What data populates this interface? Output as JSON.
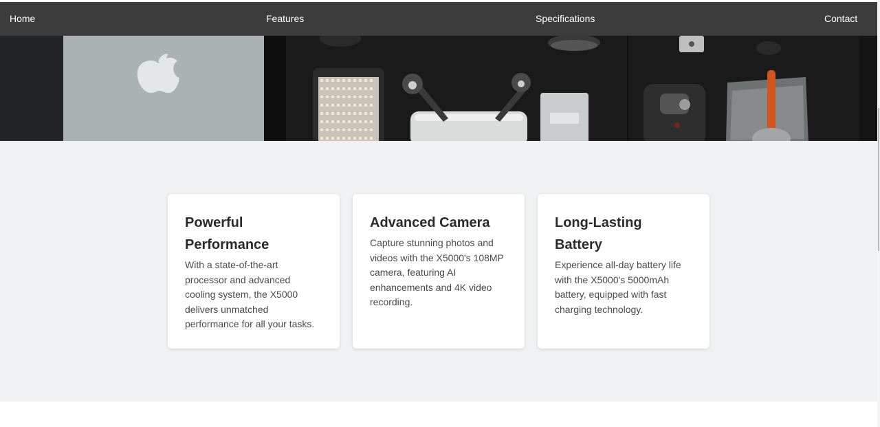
{
  "nav": {
    "home": "Home",
    "features": "Features",
    "specifications": "Specifications",
    "contact": "Contact"
  },
  "hero": {
    "image": "flat-lay-of-laptop-drone-led-light-and-camera-gear",
    "tone": "grayscale with orange accent"
  },
  "features": [
    {
      "title": "Powerful Performance",
      "text": "With a state-of-the-art processor and advanced cooling system, the X5000 delivers unmatched performance for all your tasks."
    },
    {
      "title": "Advanced Camera",
      "text": "Capture stunning photos and videos with the X5000's 108MP camera, featuring AI enhancements and 4K video recording."
    },
    {
      "title": "Long-Lasting Battery",
      "text": "Experience all-day battery life with the X5000's 5000mAh battery, equipped with fast charging technology."
    }
  ],
  "colors": {
    "navbar": "#3c3c3c",
    "section_bg": "#f0f1f3",
    "card_bg": "#ffffff",
    "heading": "#2a2a2a",
    "body_text": "#4a4a4a"
  }
}
